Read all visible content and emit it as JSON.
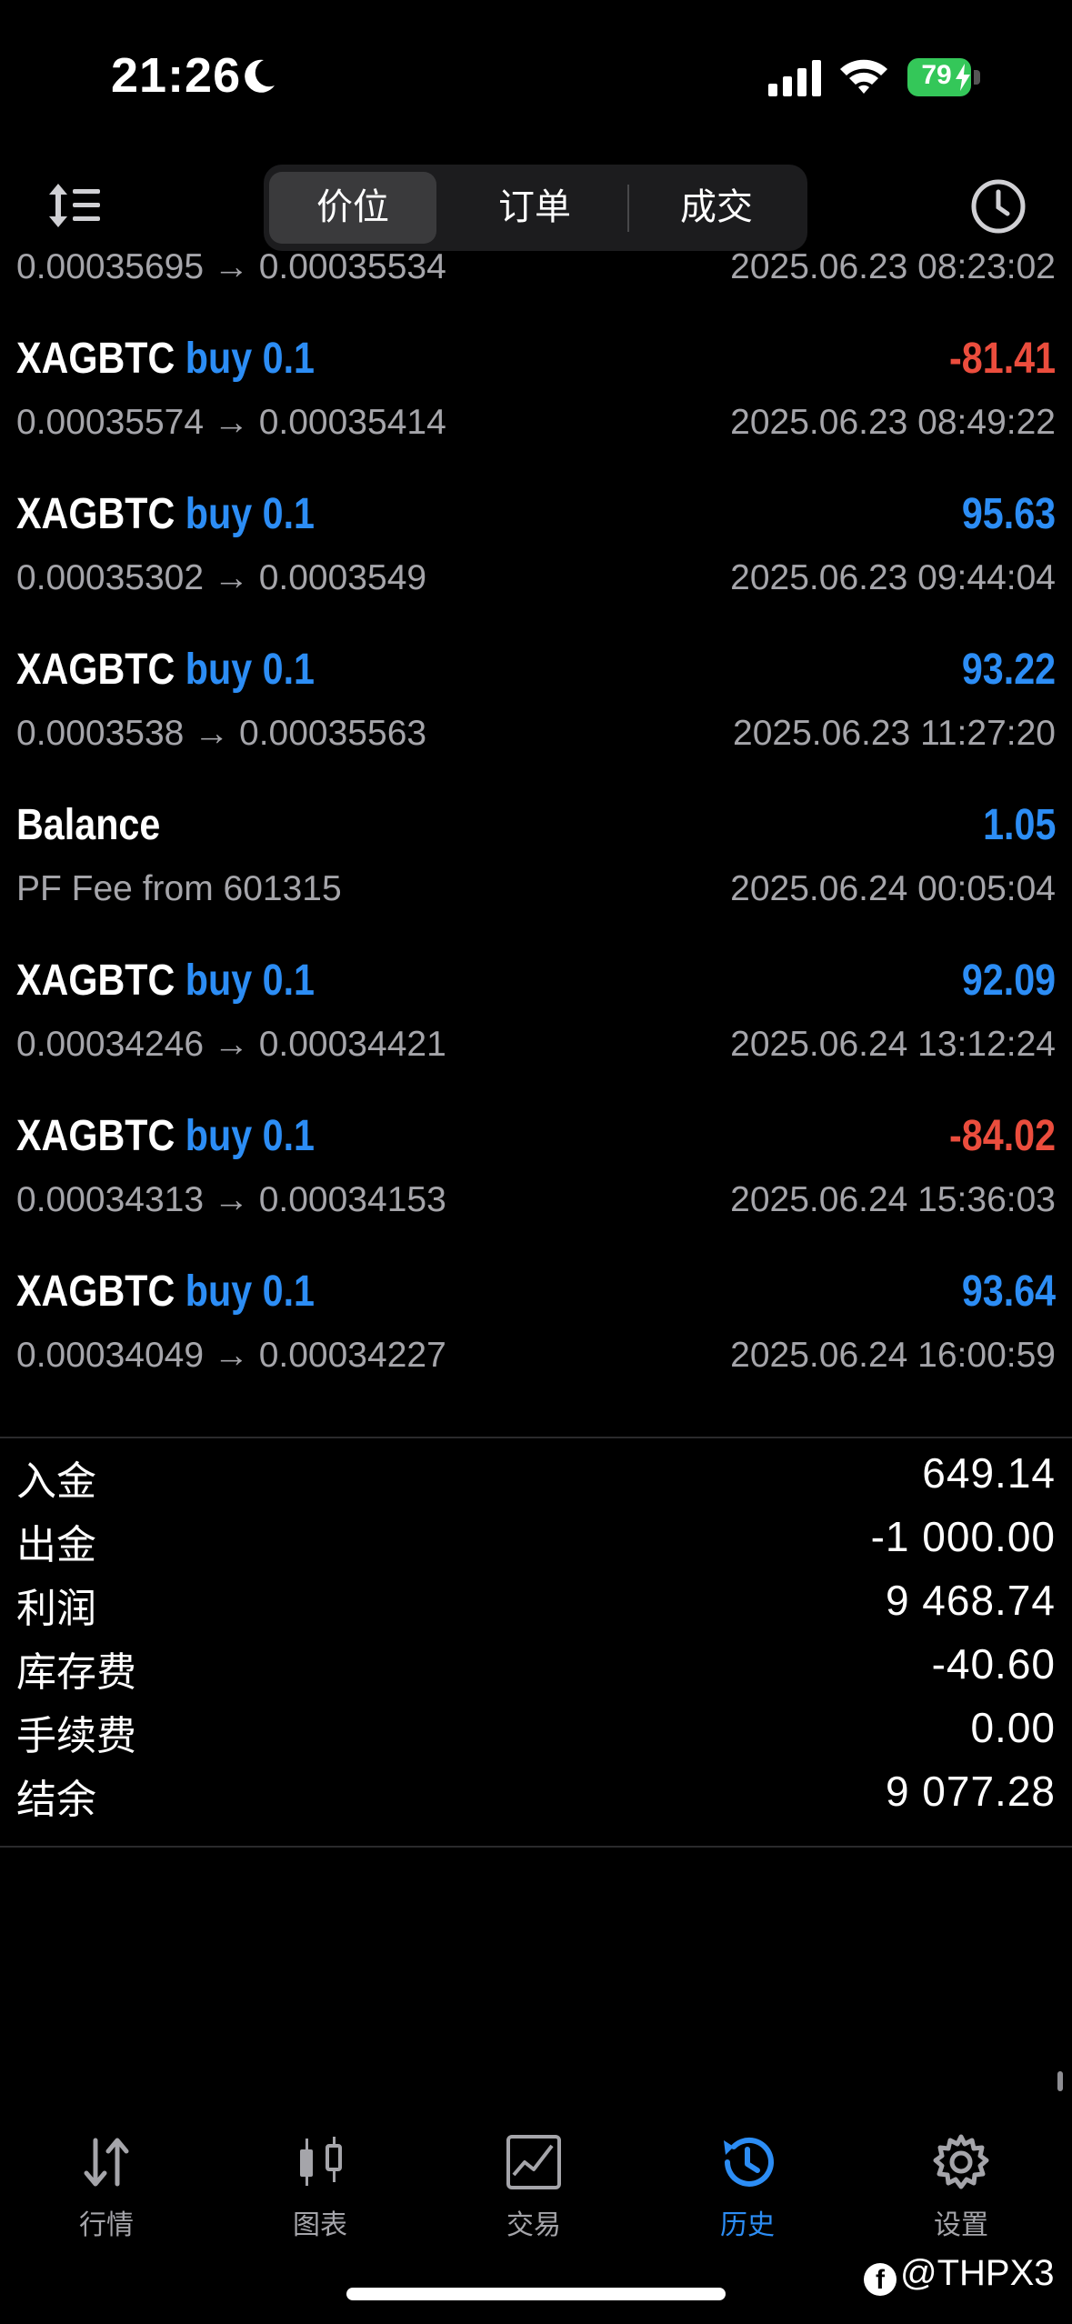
{
  "status_bar": {
    "time": "21:26",
    "battery": "79"
  },
  "segments": [
    "价位",
    "订单",
    "成交"
  ],
  "deals": [
    {
      "symbol": "",
      "direction": "",
      "profit": "",
      "prices": "0.00035695 → 0.00035534",
      "date": "2025.06.23 08:23:02",
      "profit_sign": "pos"
    },
    {
      "symbol": "XAGBTC",
      "direction": "buy 0.1",
      "profit": "-81.41",
      "prices": "0.00035574 → 0.00035414",
      "date": "2025.06.23 08:49:22",
      "profit_sign": "neg"
    },
    {
      "symbol": "XAGBTC",
      "direction": "buy 0.1",
      "profit": "95.63",
      "prices": "0.00035302 → 0.0003549",
      "date": "2025.06.23 09:44:04",
      "profit_sign": "pos"
    },
    {
      "symbol": "XAGBTC",
      "direction": "buy 0.1",
      "profit": "93.22",
      "prices": "0.0003538 → 0.00035563",
      "date": "2025.06.23 11:27:20",
      "profit_sign": "pos"
    },
    {
      "symbol": "Balance",
      "direction": "",
      "profit": "1.05",
      "prices": "PF Fee from 601315",
      "date": "2025.06.24 00:05:04",
      "profit_sign": "pos"
    },
    {
      "symbol": "XAGBTC",
      "direction": "buy 0.1",
      "profit": "92.09",
      "prices": "0.00034246 → 0.00034421",
      "date": "2025.06.24 13:12:24",
      "profit_sign": "pos"
    },
    {
      "symbol": "XAGBTC",
      "direction": "buy 0.1",
      "profit": "-84.02",
      "prices": "0.00034313 → 0.00034153",
      "date": "2025.06.24 15:36:03",
      "profit_sign": "neg"
    },
    {
      "symbol": "XAGBTC",
      "direction": "buy 0.1",
      "profit": "93.64",
      "prices": "0.00034049 → 0.00034227",
      "date": "2025.06.24 16:00:59",
      "profit_sign": "pos"
    }
  ],
  "summary": [
    {
      "label": "入金",
      "value": "649.14"
    },
    {
      "label": "出金",
      "value": "-1 000.00"
    },
    {
      "label": "利润",
      "value": "9 468.74"
    },
    {
      "label": "库存费",
      "value": "-40.60"
    },
    {
      "label": "手续费",
      "value": "0.00"
    },
    {
      "label": "结余",
      "value": "9 077.28"
    }
  ],
  "tabs": [
    "行情",
    "图表",
    "交易",
    "历史",
    "设置"
  ],
  "watermark": "@THPX3",
  "colors": {
    "accent": "#2c8df5",
    "negative": "#eb4d3d",
    "background": "#000000"
  }
}
